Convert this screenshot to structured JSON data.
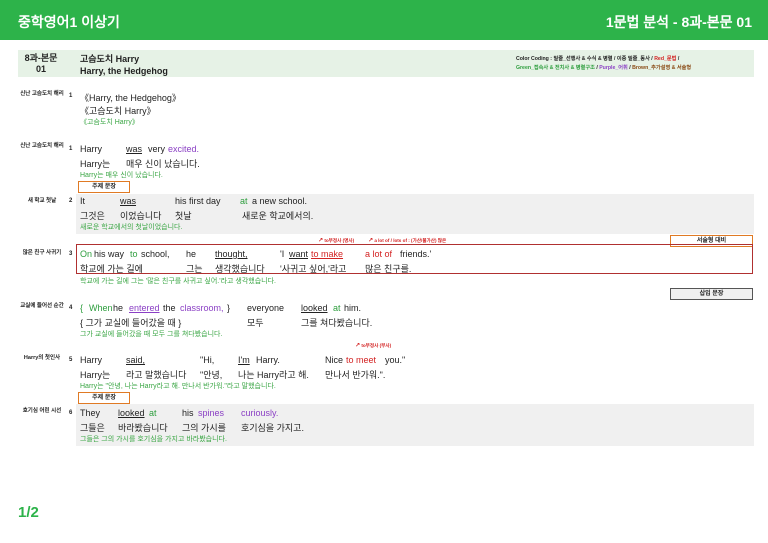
{
  "header": {
    "title_left": "중학영어1 이상기",
    "title_right": "1문법 분석 - 8과-본문 01"
  },
  "lesson": {
    "label_line1": "8과-본문",
    "label_line2": "01",
    "title_ko": "고슴도치 Harry",
    "title_en": "Harry, the Hedgehog"
  },
  "color_coding": {
    "prefix": "Color Coding : ",
    "black": "밑줄_선행사 & 수식 & 병렬 / 이중 밑줄_동사 / ",
    "red": "Red_문법",
    "slash1": " /",
    "green": "Green_접속사 & 전치사 & 병렬구조",
    "slash2": " / ",
    "purple": "Purple_어휘",
    "slash3": " / ",
    "brown": "Brown_추가설명 & 서술형"
  },
  "rows": [
    {
      "label": "신난 고슴도치 해리",
      "num": "1",
      "en": "《Harry, the Hedgehog》",
      "ko": "《고슴도치 Harry》",
      "tr": "《고슴도치 Harry》"
    },
    {
      "label": "신난 고슴도치 해리",
      "num": "1",
      "en": [
        "Harry",
        "was",
        "very",
        "excited."
      ],
      "ko": [
        "Harry는",
        "매우 신이 났습니다."
      ],
      "tr": "Harry는 매우 신이 났습니다."
    },
    {
      "tag": "주제 문장",
      "label": "새 학교 첫날",
      "num": "2",
      "en": [
        "It",
        "was",
        "his first day",
        "at",
        "a new school."
      ],
      "ko": [
        "그것은",
        "이었습니다",
        "첫날",
        "새로운 학교에서의."
      ],
      "tr": "새로운 학교에서의 첫날이었습니다."
    },
    {
      "tag": "서술형 대비",
      "note1": "to부정사 (명사)",
      "note2": "a lot of / lots of : (가산/불가산) 많은",
      "label": "많은 친구 사귀기",
      "num": "3",
      "en": [
        "On",
        "his way",
        "to",
        "school,",
        "he",
        "thought,",
        "'I",
        "want",
        "to make",
        "a lot of",
        "friends.'"
      ],
      "ko": [
        "학교에 가는 길에",
        "그는",
        "생각했습니다",
        "'사귀고 싶어,'라고",
        "많은 친구를."
      ],
      "tr": "학교에 가는 길에 그는 '많은 친구를 사귀고 싶어.'라고 생각했습니다."
    },
    {
      "tag": "삽입 문장",
      "label": "교실에 들어선 순간",
      "num": "4",
      "en": [
        "{",
        "When",
        "he",
        "entered",
        "the",
        "classroom,",
        "}",
        "everyone",
        "looked",
        "at",
        "him."
      ],
      "ko": [
        "{ 그가 교실에 들어갔을 때 }",
        "모두",
        "그를 쳐다봤습니다."
      ],
      "tr": "그가 교실에 들어갔을 때 모두 그를 쳐다봤습니다."
    },
    {
      "note1": "to부정사 (부사)",
      "label": "Harry의 첫인사",
      "num": "5",
      "en": [
        "Harry",
        "said,",
        "\"Hi,",
        "I'm",
        "Harry.",
        "Nice",
        "to meet",
        "you.\""
      ],
      "ko": [
        "Harry는",
        "라고 말했습니다",
        "\"안녕,",
        "나는 Harry라고 해.",
        "만나서 반가워.\"."
      ],
      "tr": "Harry는 \"안녕, 나는 Harry라고 해. 만나서 반가워.\"라고 말했습니다."
    },
    {
      "tag": "주제 문장",
      "label": "호기심 어린 시선",
      "num": "6",
      "en": [
        "They",
        "looked",
        "at",
        "his",
        "spines",
        "curiously."
      ],
      "ko": [
        "그들은",
        "바라봤습니다",
        "그의 가시를",
        "호기심을 가지고."
      ],
      "tr": "그들은 그의 가시를 호기심을 가지고 바라봤습니다."
    }
  ],
  "pager": "1/2"
}
